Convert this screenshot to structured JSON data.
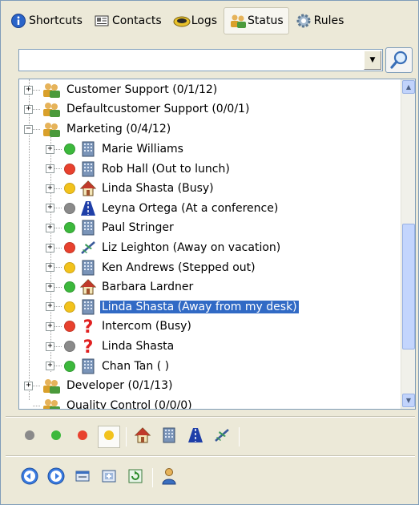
{
  "tabs": [
    {
      "label": "Shortcuts",
      "icon": "info-icon"
    },
    {
      "label": "Contacts",
      "icon": "contacts-card-icon"
    },
    {
      "label": "Logs",
      "icon": "phone-handset-icon"
    },
    {
      "label": "Status",
      "icon": "people-group-icon",
      "active": true
    },
    {
      "label": "Rules",
      "icon": "gear-icon"
    }
  ],
  "search": {
    "value": "",
    "placeholder": ""
  },
  "tree": {
    "groups_top": [
      {
        "label": "Customer Support   (0/1/12)"
      },
      {
        "label": "Defaultcustomer Support   (0/0/1)"
      },
      {
        "label": "Marketing   (0/4/12)"
      }
    ],
    "members": [
      {
        "label": "Marie Williams",
        "status": "green",
        "icon": "office-building-icon"
      },
      {
        "label": "Rob Hall (Out to lunch)",
        "status": "red",
        "icon": "office-building-icon"
      },
      {
        "label": "Linda Shasta (Busy)",
        "status": "yellow",
        "icon": "home-icon"
      },
      {
        "label": "Leyna Ortega (At a conference)",
        "status": "gray",
        "icon": "road-icon"
      },
      {
        "label": "Paul Stringer",
        "status": "green",
        "icon": "office-building-icon"
      },
      {
        "label": "Liz Leighton (Away on vacation)",
        "status": "red",
        "icon": "airplane-icon"
      },
      {
        "label": "Ken Andrews (Stepped out)",
        "status": "yellow",
        "icon": "office-building-icon"
      },
      {
        "label": "Barbara Lardner",
        "status": "green",
        "icon": "home-icon"
      },
      {
        "label": "Linda Shasta (Away from my desk)",
        "status": "yellow",
        "icon": "office-building-icon",
        "selected": true
      },
      {
        "label": "Intercom (Busy)",
        "status": "red",
        "icon": "question-mark-icon"
      },
      {
        "label": "Linda Shasta",
        "status": "gray",
        "icon": "question-mark-icon"
      },
      {
        "label": "Chan Tan ( )",
        "status": "green",
        "icon": "office-building-icon"
      }
    ],
    "groups_bottom": [
      {
        "label": "Developer   (0/1/13)"
      },
      {
        "label": "Quality Control   (0/0/0)"
      }
    ]
  },
  "colors": {
    "green": "#3cb83c",
    "red": "#e8412e",
    "yellow": "#f2c21c",
    "gray": "#8a8a8a",
    "selection": "#316ac5"
  },
  "toolbar_status": [
    "gray-status-icon",
    "green-status-icon",
    "red-status-icon",
    "yellow-status-icon",
    "home-icon",
    "office-building-icon",
    "road-icon",
    "airplane-icon"
  ],
  "toolbar_actions": [
    "back-arrow-icon",
    "forward-arrow-icon",
    "window-icon",
    "add-window-icon",
    "refresh-icon",
    "user-icon"
  ]
}
